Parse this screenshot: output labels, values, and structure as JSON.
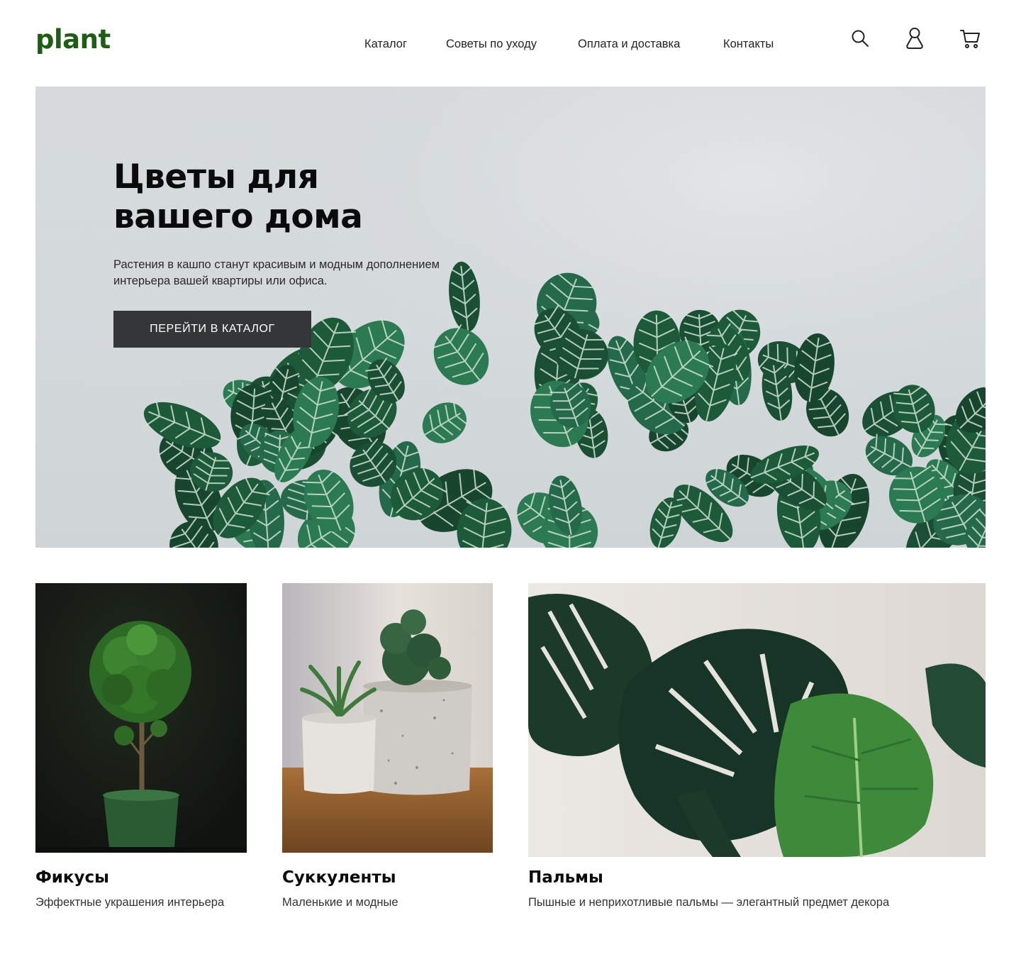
{
  "header": {
    "logo": "plant",
    "nav": [
      "Каталог",
      "Советы по уходу",
      "Оплата и доставка",
      "Контакты"
    ],
    "icons": [
      "search-icon",
      "user-icon",
      "cart-icon"
    ]
  },
  "hero": {
    "title_line1": "Цветы для",
    "title_line2": "вашего дома",
    "text": "Растения в кашпо станут красивым и модным дополнением интерьера вашей квартиры или офиса.",
    "button": "ПЕРЕЙТИ В КАТАЛОГ"
  },
  "categories": [
    {
      "title": "Фикусы",
      "desc": "Эффектные украшения интерьера"
    },
    {
      "title": "Суккуленты",
      "desc": "Маленькие и модные"
    },
    {
      "title": "Пальмы",
      "desc": "Пышные и неприхотливые пальмы — элегантный предмет декора"
    }
  ],
  "colors": {
    "brand": "#1f5c14",
    "button_bg": "#353637",
    "hero_bg": "#d5d9dc",
    "leaf_dark": "#1f6b45",
    "leaf_light": "#cfe3d6"
  }
}
